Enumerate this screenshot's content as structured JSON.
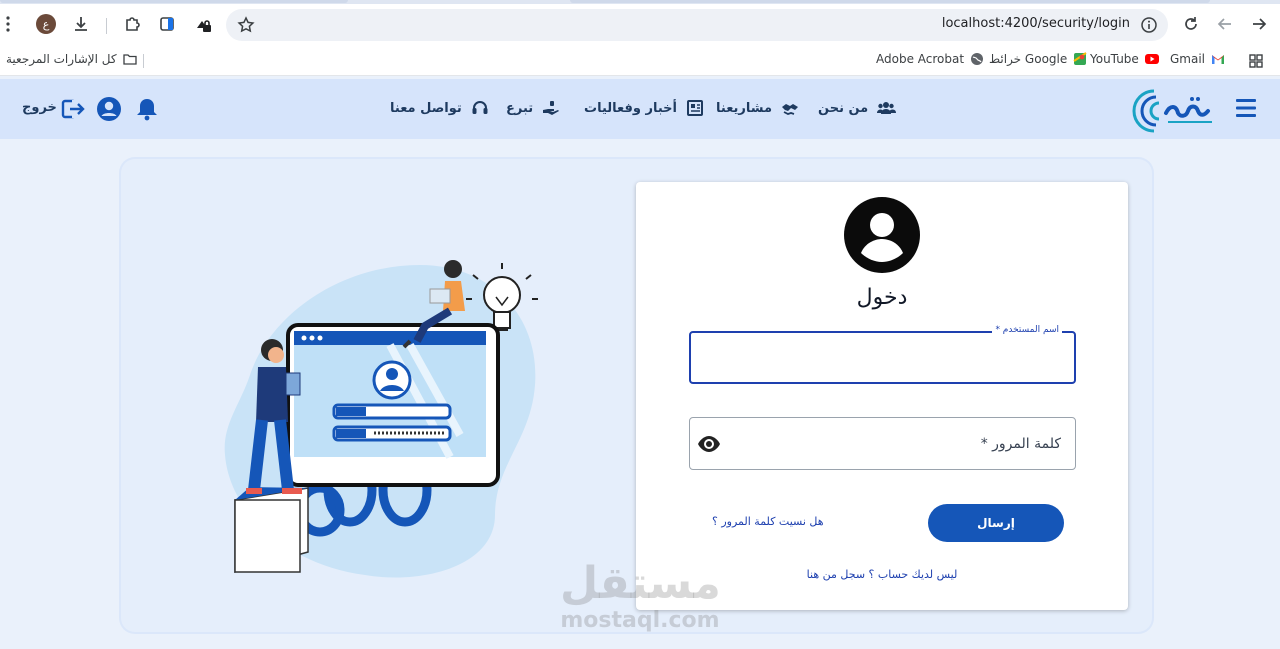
{
  "browser": {
    "url": "localhost:4200/security/login",
    "profile_initial": "ع",
    "bookmarks": {
      "all_bookmarks": "كل الإشارات المرجعية",
      "adobe": "Adobe Acrobat",
      "maps": "خرائط Google",
      "youtube": "YouTube",
      "gmail": "Gmail"
    }
  },
  "nav": {
    "logout": "خروج",
    "about": "من نحن",
    "projects": "مشاريعنا",
    "news": "أخبار وفعاليات",
    "donate": "تبرع",
    "contact": "تواصل معنا"
  },
  "login": {
    "title": "دخول",
    "username_label": "اسم المستخدم *",
    "password_placeholder": "كلمة المرور *",
    "submit": "إرسال",
    "forgot": "هل نسيت كلمة المرور ؟",
    "register": "ليس لديك حساب ؟ سجل من هنا"
  },
  "watermark": {
    "arabic": "مستقل",
    "latin": "mostaql.com"
  },
  "colors": {
    "primary": "#1556b8",
    "nav_bg": "#d6e4fb",
    "panel_bg": "#e5eefb"
  }
}
